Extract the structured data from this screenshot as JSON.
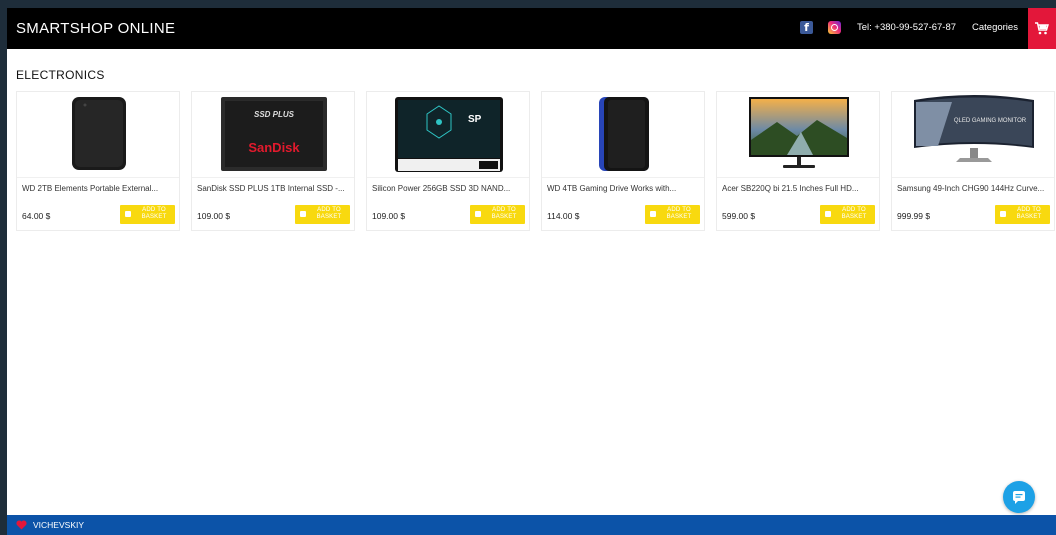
{
  "header": {
    "brand": "SMARTSHOP ONLINE",
    "phone": "Tel: +380-99-527-67-87",
    "categories_label": "Categories",
    "facebook_glyph": "f",
    "icons": [
      "facebook-icon",
      "instagram-icon",
      "cart-icon"
    ],
    "cart_color": "#e3173a"
  },
  "section": {
    "title": "ELECTRONICS"
  },
  "products": [
    {
      "name": "WD 2TB Elements Portable External...",
      "price": "64.00 $",
      "button": "ADD TO BASKET",
      "image": "external-hdd-black"
    },
    {
      "name": "SanDisk SSD PLUS 1TB Internal SSD -...",
      "price": "109.00 $",
      "button": "ADD TO BASKET",
      "image": "sandisk-ssd"
    },
    {
      "name": "Silicon Power 256GB SSD 3D NAND...",
      "price": "109.00 $",
      "button": "ADD TO BASKET",
      "image": "silicon-power-ssd"
    },
    {
      "name": "WD 4TB Gaming Drive Works with...",
      "price": "114.00 $",
      "button": "ADD TO BASKET",
      "image": "gaming-drive-blue"
    },
    {
      "name": "Acer SB220Q bi 21.5 Inches Full HD...",
      "price": "599.00 $",
      "button": "ADD TO BASKET",
      "image": "acer-monitor"
    },
    {
      "name": "Samsung 49-Inch CHG90 144Hz Curve...",
      "price": "999.99 $",
      "button": "ADD TO BASKET",
      "image": "samsung-curved-monitor"
    }
  ],
  "product_images": {
    "sandisk_top": "SSD PLUS",
    "sandisk_brand": "SanDisk",
    "silicon_power_logo": "SP",
    "samsung_screen_text": "QLED GAMING MONITOR"
  },
  "footer": {
    "name": "VICHEVSKIY"
  },
  "colors": {
    "header_bg": "#000000",
    "basket_button": "#f8d90f",
    "footer_bg": "#0c53a8",
    "chat_button": "#1da1e6"
  }
}
